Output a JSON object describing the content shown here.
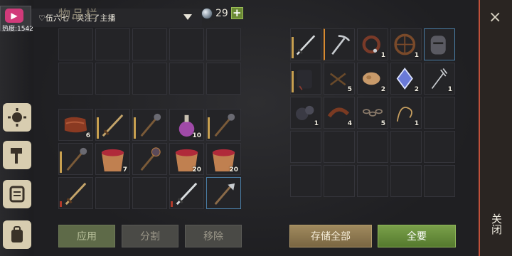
{
  "header": {
    "live_badge_icon": "live-stream-icon",
    "live_badge_heat": "热度:1542",
    "streamer_text": "♡伍六七 · 关注了主播",
    "inventory_title": "物品栏",
    "gem_count": "29",
    "add_gem_label": "+"
  },
  "sidebar": {
    "items": [
      {
        "name": "settings-sun-icon"
      },
      {
        "name": "hammer-icon"
      },
      {
        "name": "scroll-quest-icon"
      },
      {
        "name": "backpack-icon"
      }
    ]
  },
  "inventory": {
    "top_slots": [
      {},
      {},
      {},
      {},
      {},
      {},
      {},
      {},
      {},
      {}
    ],
    "bottom_slots": [
      {
        "item": "leather",
        "count": "6"
      },
      {
        "item": "wooden-sword",
        "count": "",
        "dur": "tan"
      },
      {
        "item": "mace",
        "count": "",
        "dur": "tan"
      },
      {
        "item": "potion",
        "count": "10"
      },
      {
        "item": "mace",
        "count": "",
        "dur": "tan"
      },
      {
        "item": "mace",
        "count": "",
        "dur": "tan"
      },
      {
        "item": "berry-bucket",
        "count": "7"
      },
      {
        "item": "morningstar",
        "count": ""
      },
      {
        "item": "berry-bucket",
        "count": "20"
      },
      {
        "item": "berry-bucket",
        "count": "20"
      },
      {
        "item": "wooden-sword",
        "count": "",
        "dur": "red"
      },
      {
        "item": "",
        "count": ""
      },
      {
        "item": "",
        "count": ""
      },
      {
        "item": "steel-sword",
        "count": "",
        "dur": "red"
      },
      {
        "item": "halberd",
        "count": "",
        "sel": "blue"
      }
    ]
  },
  "storage": {
    "slots": [
      {
        "item": "steel-sword",
        "count": "",
        "dur": "tan"
      },
      {
        "item": "pickaxe",
        "count": "",
        "sel": "orange"
      },
      {
        "item": "collar",
        "count": "1"
      },
      {
        "item": "wheel",
        "count": "1"
      },
      {
        "item": "knight-helmet",
        "count": "",
        "sel": "blue"
      },
      {
        "item": "dark-armor",
        "count": "",
        "dur": "tan"
      },
      {
        "item": "crossed-sticks",
        "count": "5"
      },
      {
        "item": "seeds",
        "count": "2"
      },
      {
        "item": "crystal",
        "count": "2"
      },
      {
        "item": "trident-fork",
        "count": "1"
      },
      {
        "item": "gears",
        "count": "1"
      },
      {
        "item": "leather-strap",
        "count": "4"
      },
      {
        "item": "chain",
        "count": "5"
      },
      {
        "item": "rope",
        "count": "1"
      },
      {
        "item": "",
        "count": ""
      },
      {
        "item": "",
        "count": ""
      },
      {
        "item": "",
        "count": ""
      },
      {
        "item": "",
        "count": ""
      },
      {
        "item": "",
        "count": ""
      },
      {
        "item": "",
        "count": ""
      },
      {
        "item": "",
        "count": ""
      },
      {
        "item": "",
        "count": ""
      },
      {
        "item": "",
        "count": ""
      },
      {
        "item": "",
        "count": ""
      },
      {
        "item": "",
        "count": ""
      }
    ]
  },
  "buttons": {
    "apply": "应用",
    "split": "分割",
    "remove": "移除",
    "store_all": "存储全部",
    "take_all": "全要"
  },
  "close_panel": {
    "close_icon": "×",
    "close_text": "关闭"
  },
  "colors": {
    "accent_green": "#6b8a35",
    "close_border": "#c0503a"
  }
}
